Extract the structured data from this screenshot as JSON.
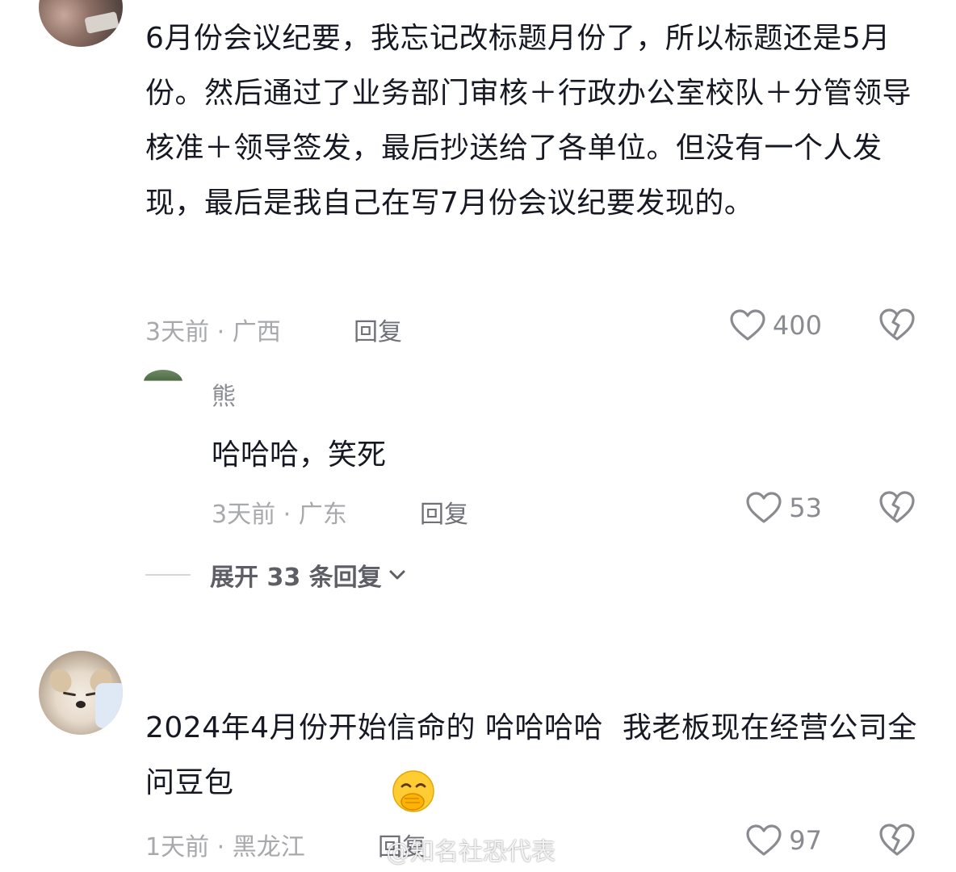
{
  "comments": [
    {
      "text": "6月份会议纪要，我忘记改标题月份了，所以标题还是5月份。然后通过了业务部门审核＋行政办公室校队＋分管领导核准＋领导签发，最后抄送给了各单位。但没有一个人发现，最后是我自己在写7月份会议纪要发现的。",
      "meta": "3天前 · 广西",
      "reply_label": "回复",
      "likes": "400",
      "replies": [
        {
          "username": "熊",
          "text": "哈哈哈，笑死",
          "meta": "3天前 · 广东",
          "reply_label": "回复",
          "likes": "53"
        }
      ],
      "expand_label": "展开 33 条回复"
    },
    {
      "text": "2024年4月份开始信命的 哈哈哈哈  我老板现在经营公司全问豆包",
      "meta": "1天前 · 黑龙江",
      "reply_label": "回复",
      "likes": "97"
    }
  ],
  "watermark": "@知名社恐代表",
  "icons": {
    "like": "heart-outline-icon",
    "dislike": "broken-heart-icon",
    "expand": "chevron-down-icon",
    "emoji": "covering-mouth-smile-emoji"
  },
  "colors": {
    "text": "#161823",
    "meta": "#a8a9ad",
    "action": "#6f7078"
  }
}
